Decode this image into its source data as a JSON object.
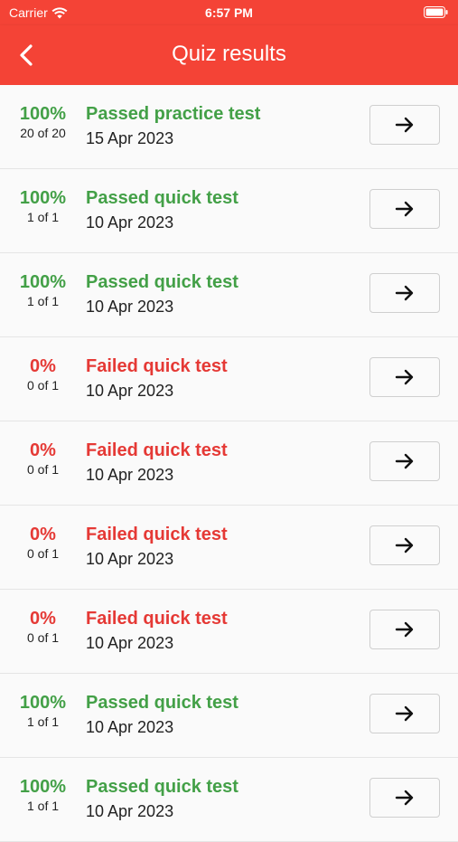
{
  "status_bar": {
    "carrier": "Carrier",
    "time": "6:57 PM"
  },
  "header": {
    "title": "Quiz results"
  },
  "colors": {
    "header": "#f44336",
    "pass": "#43a047",
    "fail": "#e53935"
  },
  "results": [
    {
      "percent": "100%",
      "count": "20 of 20",
      "title": "Passed practice test",
      "date": "15 Apr 2023",
      "status": "pass"
    },
    {
      "percent": "100%",
      "count": "1 of 1",
      "title": "Passed quick test",
      "date": "10 Apr 2023",
      "status": "pass"
    },
    {
      "percent": "100%",
      "count": "1 of 1",
      "title": "Passed quick test",
      "date": "10 Apr 2023",
      "status": "pass"
    },
    {
      "percent": "0%",
      "count": "0 of 1",
      "title": "Failed quick test",
      "date": "10 Apr 2023",
      "status": "fail"
    },
    {
      "percent": "0%",
      "count": "0 of 1",
      "title": "Failed quick test",
      "date": "10 Apr 2023",
      "status": "fail"
    },
    {
      "percent": "0%",
      "count": "0 of 1",
      "title": "Failed quick test",
      "date": "10 Apr 2023",
      "status": "fail"
    },
    {
      "percent": "0%",
      "count": "0 of 1",
      "title": "Failed quick test",
      "date": "10 Apr 2023",
      "status": "fail"
    },
    {
      "percent": "100%",
      "count": "1 of 1",
      "title": "Passed quick test",
      "date": "10 Apr 2023",
      "status": "pass"
    },
    {
      "percent": "100%",
      "count": "1 of 1",
      "title": "Passed quick test",
      "date": "10 Apr 2023",
      "status": "pass"
    }
  ]
}
